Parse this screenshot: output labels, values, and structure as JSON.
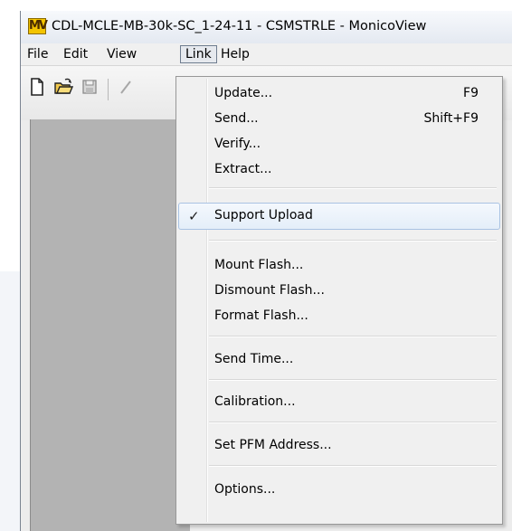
{
  "window": {
    "title": "CDL-MCLE-MB-30k-SC_1-24-11 - CSMSTRLE - MonicoView",
    "logo_text": "MV"
  },
  "menubar": {
    "items": [
      {
        "label": "File"
      },
      {
        "label": "Edit"
      },
      {
        "label": "View"
      },
      {
        "label": "Link"
      },
      {
        "label": "Help"
      }
    ]
  },
  "toolbar": {
    "icons": [
      "new-file-icon",
      "open-folder-icon",
      "save-icon",
      "edit-pencil-icon"
    ]
  },
  "link_menu": {
    "items": [
      {
        "label": "Update...",
        "shortcut": "F9"
      },
      {
        "label": "Send...",
        "shortcut": "Shift+F9"
      },
      {
        "label": "Verify...",
        "shortcut": ""
      },
      {
        "label": "Extract...",
        "shortcut": ""
      },
      {
        "label": "Support Upload",
        "checked": true,
        "check_glyph": "✓"
      },
      {
        "label": "Mount Flash..."
      },
      {
        "label": "Dismount Flash..."
      },
      {
        "label": "Format Flash..."
      },
      {
        "label": "Send Time..."
      },
      {
        "label": "Calibration..."
      },
      {
        "label": "Set PFM Address..."
      },
      {
        "label": "Options..."
      }
    ]
  },
  "colors": {
    "menu_bg": "#f0f0f0",
    "highlight_border": "#a9c3e3",
    "doc_area": "#b3b3b3"
  }
}
